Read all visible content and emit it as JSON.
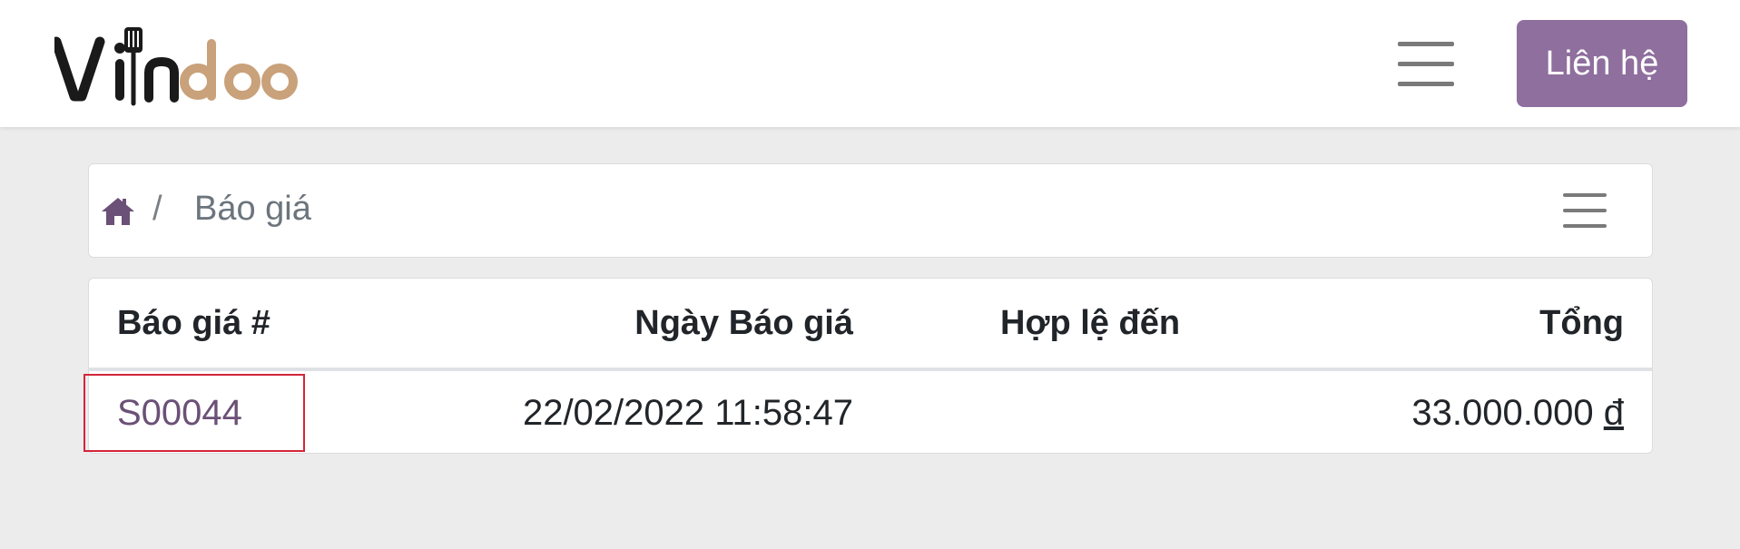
{
  "brand": {
    "logo_text": "Viindoo",
    "logo_dark_color": "#1a1a1a",
    "logo_accent_color": "#c9a17a"
  },
  "header": {
    "contact_label": "Liên hệ",
    "contact_color": "#8f6f9e",
    "menu_icon": "hamburger-icon"
  },
  "breadcrumb": {
    "home_icon": "home-icon",
    "separator": "/",
    "current": "Báo giá",
    "menu_icon": "hamburger-icon"
  },
  "table": {
    "headers": [
      "Báo giá #",
      "Ngày Báo giá",
      "Hợp lệ đến",
      "Tổng"
    ],
    "rows": [
      {
        "number": "S00044",
        "date": "22/02/2022 11:58:47",
        "valid_until": "",
        "total_amount": "33.000.000",
        "currency": "đ"
      }
    ]
  },
  "annotation": {
    "highlight_color": "#d3263a"
  }
}
